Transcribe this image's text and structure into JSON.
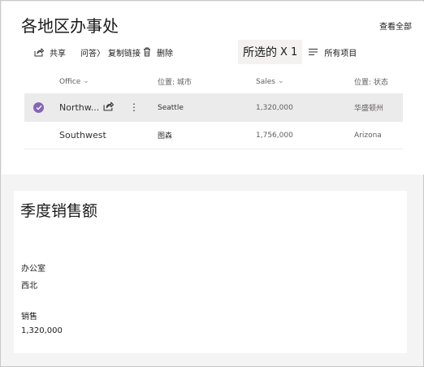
{
  "list_webpart": {
    "title": "各地区办事处",
    "see_all": "查看全部",
    "commands": {
      "share": "共享",
      "qa": "问答〉",
      "copy_link": "复制链接",
      "delete": "删除",
      "selected_label": "所选的",
      "selected_count": "X 1",
      "view": "所有项目"
    },
    "columns": {
      "office": "Office",
      "city": "位置: 城市",
      "sales": "Sales",
      "state": "位置: 状态"
    },
    "rows": [
      {
        "office": "Northw...",
        "city": "Seattle",
        "sales": "1,320,000",
        "state": "华盛顿州",
        "selected": true
      },
      {
        "office": "Southwest",
        "city": "图森",
        "sales": "1,756,000",
        "state": "Arizona",
        "selected": false
      }
    ],
    "accent_color": "#8764b8",
    "icons": [
      "share-icon",
      "trash-icon",
      "view-list-icon",
      "checkmark-icon",
      "chevron-down-icon",
      "more-icon"
    ]
  },
  "detail_webpart": {
    "title": "季度销售额",
    "office_label": "办公室",
    "office_value": "西北",
    "sales_label": "销售",
    "sales_value": "1,320,000"
  }
}
